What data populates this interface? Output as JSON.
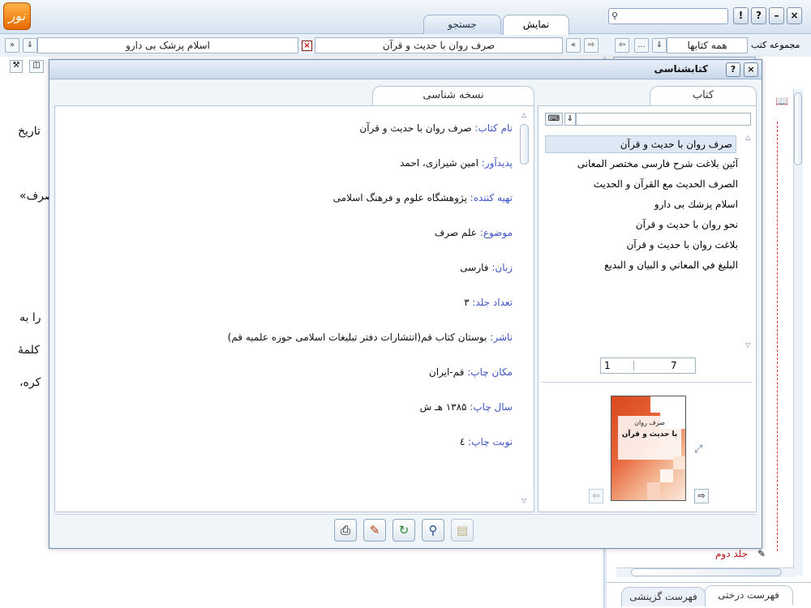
{
  "app": {
    "logo_text": "نور"
  },
  "top_tabs": [
    {
      "label": "نمایش",
      "active": true
    },
    {
      "label": "جستجو",
      "active": false
    }
  ],
  "window_buttons": {
    "close": "×",
    "minimize": "–",
    "help": "?",
    "alert": "!"
  },
  "toolbar": {
    "collection_label": "مجموعه کتب",
    "collection_value": "همه کتابها",
    "more": "...",
    "open_book_1": "صرف روان با حدیث و قرآن",
    "open_book_2": "اسلام پزشک بی دارو",
    "close_tab": "×"
  },
  "background": {
    "line_1": "تاریخ",
    "line_2": "صرف»",
    "line_3": "را به",
    "line_4": "کلمهٔ",
    "line_5": "کره،",
    "tree_bottom_item": "جلد دوم",
    "bottom_tab_1": "فهرست درختی",
    "bottom_tab_2": "فهرست گزینشی"
  },
  "dialog": {
    "title": "کتابشناسی",
    "left_tab": "نسخه شناسی",
    "right_tab": "کتاب",
    "fields": [
      {
        "label": "نام کتاب:",
        "value": "صرف روان با حدیث و قرآن"
      },
      {
        "label": "پدیدآور:",
        "value": "امین شیرازی، احمد"
      },
      {
        "label": "تهیه کننده:",
        "value": "پژوهشگاه علوم و فرهنگ اسلامی"
      },
      {
        "label": "موضوع:",
        "value": "علم صرف"
      },
      {
        "label": "زبان:",
        "value": "فارسی"
      },
      {
        "label": "تعداد جلد:",
        "value": "۳"
      },
      {
        "label": "ناشر:",
        "value": "بوستان کتاب قم(انتشارات دفتر تبلیغات اسلامی حوزه علمیه قم)"
      },
      {
        "label": "مکان چاپ:",
        "value": "قم-ایران"
      },
      {
        "label": "سال چاپ:",
        "value": "۱۳۸۵ هـ ش"
      },
      {
        "label": "نوبت چاپ:",
        "value": "٤"
      }
    ],
    "book_list": [
      {
        "title": "صرف روان با حديث و قرآن",
        "selected": true
      },
      {
        "title": "آئين بلاغت شرح فارسی مختصر المعانی",
        "selected": false
      },
      {
        "title": "الصرف الحديث مع القرآن و الحديث",
        "selected": false
      },
      {
        "title": "اسلام پزشك بی دارو",
        "selected": false
      },
      {
        "title": "نحو روان با حديث و قرآن",
        "selected": false
      },
      {
        "title": "بلاغت روان با حديث و قرآن",
        "selected": false
      },
      {
        "title": "البليغ في المعاني و البيان و البديع",
        "selected": false
      }
    ],
    "pager": {
      "current": "1",
      "total": "7"
    },
    "cover_title_1": "صرف روان",
    "cover_title_2": "با حدیث و قرآن"
  },
  "icons": {
    "search": "search-icon",
    "print": "printer-icon",
    "edit": "edit-note-icon",
    "export": "export-icon",
    "find": "magnifier-icon",
    "doc": "document-icon"
  }
}
